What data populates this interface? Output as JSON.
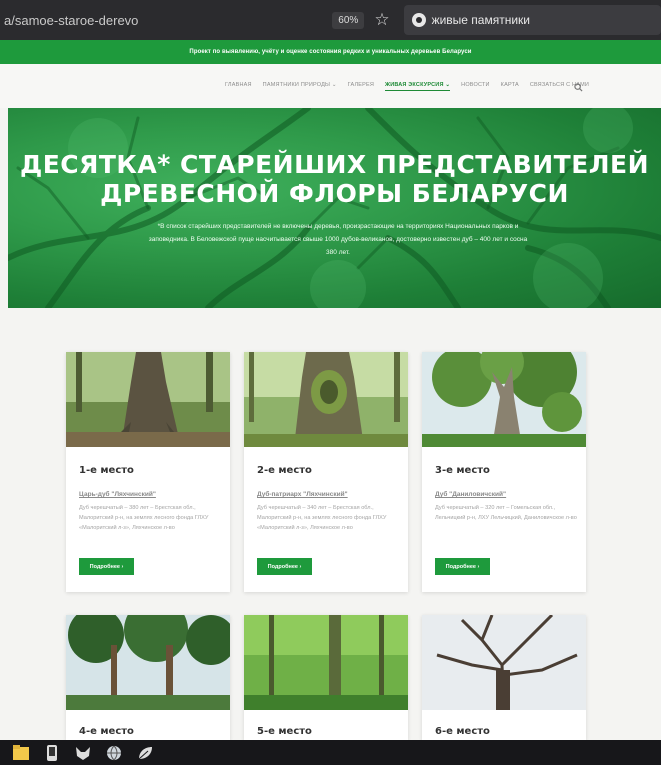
{
  "browser": {
    "url": "a/samoe-staroe-derevo",
    "zoom": "60%",
    "tab_title": "живые памятники"
  },
  "banner": {
    "text": "Проект по выявлению, учёту и оценке состояния редких и уникальных деревьев Беларуси"
  },
  "nav": {
    "items": [
      {
        "label": "Главная",
        "active": false
      },
      {
        "label": "Памятники природы ⌄",
        "active": false
      },
      {
        "label": "Галерея",
        "active": false
      },
      {
        "label": "Живая экскурсия ⌄",
        "active": true
      },
      {
        "label": "Новости",
        "active": false
      },
      {
        "label": "Карта",
        "active": false
      },
      {
        "label": "Связаться с нами",
        "active": false
      }
    ],
    "search_icon": "search-icon"
  },
  "hero": {
    "title_line1": "Десятка* старейших представителей",
    "title_line2": "древесной флоры Беларуси",
    "subtitle": "*В список старейших представителей не включены деревья, произрастающие на территориях Национальных парков и заповедника. В Беловежской пуще насчитывается свыше 1000 дубов-великанов, достоверно известен дуб – 400 лет и сосна 380 лет."
  },
  "cards": [
    {
      "place": "1-е место",
      "name": "Царь-дуб \"Ляхчинский\"",
      "desc": "Дуб черешчатый – 380 лет – Брестская обл., Малоритский р-н, на землях лесного фонда ГЛХУ «Малоритский л-з», Ляхчинское л-во",
      "button": "Подробнее ›"
    },
    {
      "place": "2-е место",
      "name": "Дуб-патриарх \"Ляхчинский\"",
      "desc": "Дуб черешчатый – 340 лет – Брестская обл., Малоритский р-н, на землях лесного фонда ГЛХУ «Малоритский л-з», Ляхчинское л-во",
      "button": "Подробнее ›"
    },
    {
      "place": "3-е место",
      "name": "Дуб \"Даниловичский\"",
      "desc": "Дуб черешчатый – 320 лет – Гомельская обл., Лельчицкий р-н, ЛХУ Лельчицкий, Даниловичское л-во",
      "button": "Подробнее ›"
    },
    {
      "place": "4-е место"
    },
    {
      "place": "5-е место"
    },
    {
      "place": "6-е место"
    }
  ],
  "taskbar": {
    "icons": [
      "folder-icon",
      "phone-icon",
      "fox-icon",
      "globe-icon",
      "leaf-icon"
    ]
  },
  "colors": {
    "brand_green": "#1e9a3c",
    "browser_bg": "#2b2b2e",
    "taskbar_bg": "#17171a"
  }
}
